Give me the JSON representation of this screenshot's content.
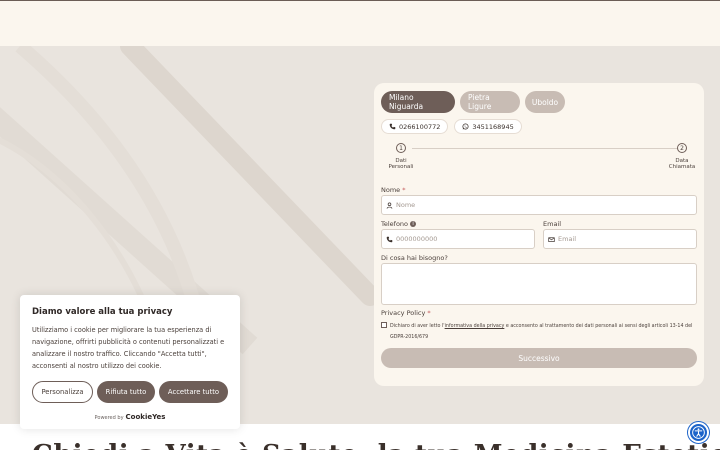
{
  "colors": {
    "brand_dark": "#6e5e58",
    "brand_light": "#c8bcb4",
    "card_bg": "#fbf6ee",
    "page_bg": "#e9e4de",
    "a11y_blue": "#1c63c9"
  },
  "locations": {
    "tabs": [
      {
        "label": "Milano Niguarda",
        "active": true
      },
      {
        "label": "Pietra Ligure",
        "active": false
      },
      {
        "label": "Uboldo",
        "active": false
      }
    ]
  },
  "phones": [
    {
      "icon": "phone-icon",
      "number": "0266100772"
    },
    {
      "icon": "whatsapp-icon",
      "number": "3451168945"
    }
  ],
  "steps": [
    {
      "num": "1",
      "label_line1": "Dati",
      "label_line2": "Personali"
    },
    {
      "num": "2",
      "label_line1": "Data",
      "label_line2": "Chiamata"
    }
  ],
  "form": {
    "name_label": "Nome",
    "name_placeholder": "Nome",
    "phone_label": "Telefono",
    "phone_placeholder": "0000000000",
    "email_label": "Email",
    "email_placeholder": "Email",
    "need_label": "Di cosa hai bisogno?",
    "privacy_label": "Privacy Policy",
    "privacy_text_before": "Dichiaro di aver letto l'",
    "privacy_link": "informativa della privacy",
    "privacy_text_after": " e acconsento al trattamento dei dati personali ai sensi degli articoli 13-14 del GDPR-2016/679",
    "submit_label": "Successivo",
    "required_mark": "*",
    "info_mark": "i"
  },
  "cookie_banner": {
    "title": "Diamo valore alla tua privacy",
    "text": "Utilizziamo i cookie per migliorare la tua esperienza di navigazione, offrirti pubblicità o contenuti personalizzati e analizzare il nostro traffico. Cliccando \"Accetta tutti\", acconsenti al nostro utilizzo dei cookie.",
    "customize_label": "Personalizza",
    "reject_label": "Rifiuta tutto",
    "accept_label": "Accettare tutto",
    "powered_by": "Powered by",
    "brand": "CookieYes"
  },
  "page": {
    "bottom_heading": "Chiedi a Vita è Salute: la tua Medicina Estetica a Milano"
  },
  "icons": {
    "accessibility": "accessibility-icon",
    "user": "user-icon",
    "phone": "phone-icon",
    "email": "email-icon",
    "whatsapp": "whatsapp-icon"
  }
}
